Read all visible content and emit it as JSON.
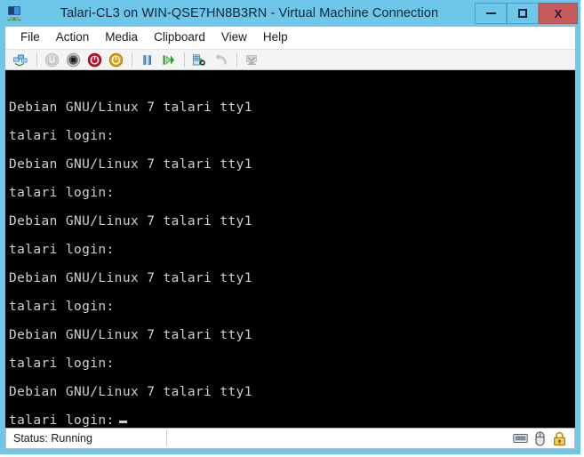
{
  "window": {
    "icon_name": "virtual-machine-icon",
    "title": "Talari-CL3 on WIN-QSE7HN8B3RN - Virtual Machine Connection",
    "vm_name": "Talari-CL3",
    "host_name": "WIN-QSE7HN8B3RN",
    "controls": {
      "minimize_label": "Minimize",
      "maximize_label": "Maximize",
      "close_label": "X"
    },
    "colors": {
      "chrome": "#6ec6e8",
      "title_text": "#10243a",
      "close_button": "#c75b5b",
      "terminal_bg": "#000000",
      "terminal_fg": "#cfcfcf"
    }
  },
  "menu": {
    "items": [
      {
        "label": "File"
      },
      {
        "label": "Action"
      },
      {
        "label": "Media"
      },
      {
        "label": "Clipboard"
      },
      {
        "label": "View"
      },
      {
        "label": "Help"
      }
    ]
  },
  "toolbar": {
    "buttons": [
      {
        "name": "ctrl-alt-delete-icon",
        "tooltip": "Ctrl+Alt+Delete",
        "enabled": true
      },
      {
        "name": "start-icon",
        "tooltip": "Start",
        "enabled": false
      },
      {
        "name": "turn-off-icon",
        "tooltip": "Turn Off",
        "enabled": true
      },
      {
        "name": "shut-down-icon",
        "tooltip": "Shut Down",
        "enabled": true
      },
      {
        "name": "save-icon",
        "tooltip": "Save",
        "enabled": true
      },
      {
        "name": "pause-icon",
        "tooltip": "Pause",
        "enabled": true
      },
      {
        "name": "reset-icon",
        "tooltip": "Reset",
        "enabled": true
      },
      {
        "name": "snapshot-icon",
        "tooltip": "Snapshot",
        "enabled": true
      },
      {
        "name": "revert-icon",
        "tooltip": "Revert",
        "enabled": false
      },
      {
        "name": "enhanced-session-icon",
        "tooltip": "Enhanced Session",
        "enabled": false
      }
    ]
  },
  "terminal": {
    "banner": "Debian GNU/Linux 7 talari tty1",
    "prompt": "talari login:",
    "lines": [
      "Debian GNU/Linux 7 talari tty1",
      "talari login:",
      "Debian GNU/Linux 7 talari tty1",
      "talari login:",
      "Debian GNU/Linux 7 talari tty1",
      "talari login:",
      "Debian GNU/Linux 7 talari tty1",
      "talari login:",
      "Debian GNU/Linux 7 talari tty1",
      "talari login:",
      "Debian GNU/Linux 7 talari tty1"
    ],
    "last_line": "talari login:",
    "cursor_visible": true
  },
  "status_bar": {
    "status_label": "Status: Running",
    "icons": [
      {
        "name": "keyboard-icon",
        "tooltip": "Keyboard input captured"
      },
      {
        "name": "mouse-icon",
        "tooltip": "Mouse input captured"
      },
      {
        "name": "lock-icon",
        "tooltip": "Secure connection"
      }
    ]
  }
}
